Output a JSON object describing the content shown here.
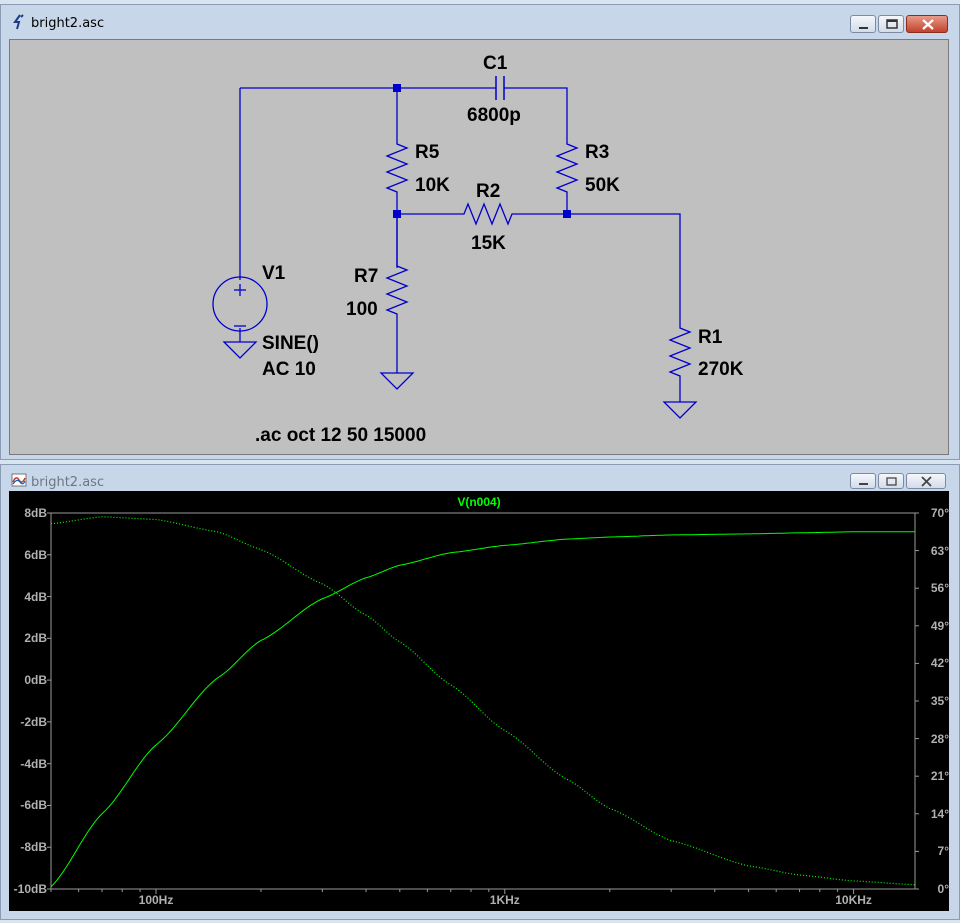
{
  "schematic_window": {
    "title": "bright2.asc",
    "components": {
      "C1": {
        "name": "C1",
        "value": "6800p"
      },
      "R5": {
        "name": "R5",
        "value": "10K"
      },
      "R3": {
        "name": "R3",
        "value": "50K"
      },
      "R2": {
        "name": "R2",
        "value": "15K"
      },
      "R7": {
        "name": "R7",
        "value": "100"
      },
      "R1": {
        "name": "R1",
        "value": "270K"
      },
      "V1": {
        "name": "V1",
        "value1": "SINE()",
        "value2": "AC 10"
      }
    },
    "directive": ".ac oct 12 50 15000",
    "wire_color": "#0000cc"
  },
  "waveform_window": {
    "title": "bright2.asc",
    "trace_label": "V(n004)",
    "trace_color": "#00ff00"
  },
  "chart_data": {
    "type": "line",
    "title": "V(n004)",
    "x_scale": "log",
    "xlim": [
      50,
      15000
    ],
    "x_ticks": [
      {
        "value": 100,
        "label": "100Hz"
      },
      {
        "value": 1000,
        "label": "1KHz"
      },
      {
        "value": 10000,
        "label": "10KHz"
      }
    ],
    "y_left": {
      "unit": "dB",
      "ylim": [
        -10,
        8
      ],
      "tick_labels": [
        "8dB",
        "6dB",
        "4dB",
        "2dB",
        "0dB",
        "-2dB",
        "-4dB",
        "-6dB",
        "-8dB",
        "-10dB"
      ]
    },
    "y_right": {
      "unit": "°",
      "ylim": [
        0,
        70
      ],
      "tick_labels": [
        "70°",
        "63°",
        "56°",
        "49°",
        "42°",
        "35°",
        "28°",
        "21°",
        "14°",
        "7°",
        "0°"
      ]
    },
    "series": [
      {
        "name": "magnitude",
        "style": "solid",
        "axis": "left",
        "x": [
          50,
          70,
          100,
          150,
          200,
          300,
          400,
          500,
          700,
          1000,
          1500,
          2000,
          3000,
          5000,
          7000,
          10000,
          15000
        ],
        "y": [
          -9.9,
          -6.4,
          -3.1,
          0.1,
          1.9,
          3.9,
          4.9,
          5.5,
          6.1,
          6.45,
          6.75,
          6.85,
          6.95,
          7.0,
          7.05,
          7.1,
          7.1
        ]
      },
      {
        "name": "phase",
        "style": "dotted",
        "axis": "right",
        "x": [
          50,
          70,
          100,
          150,
          200,
          300,
          400,
          500,
          700,
          1000,
          1500,
          2000,
          3000,
          5000,
          7000,
          10000,
          15000
        ],
        "y": [
          68,
          69.3,
          68.8,
          66.5,
          63.2,
          56.8,
          51.0,
          46.0,
          38.0,
          29.5,
          20.5,
          15.0,
          9.0,
          4.3,
          2.6,
          1.5,
          0.8
        ]
      }
    ]
  }
}
